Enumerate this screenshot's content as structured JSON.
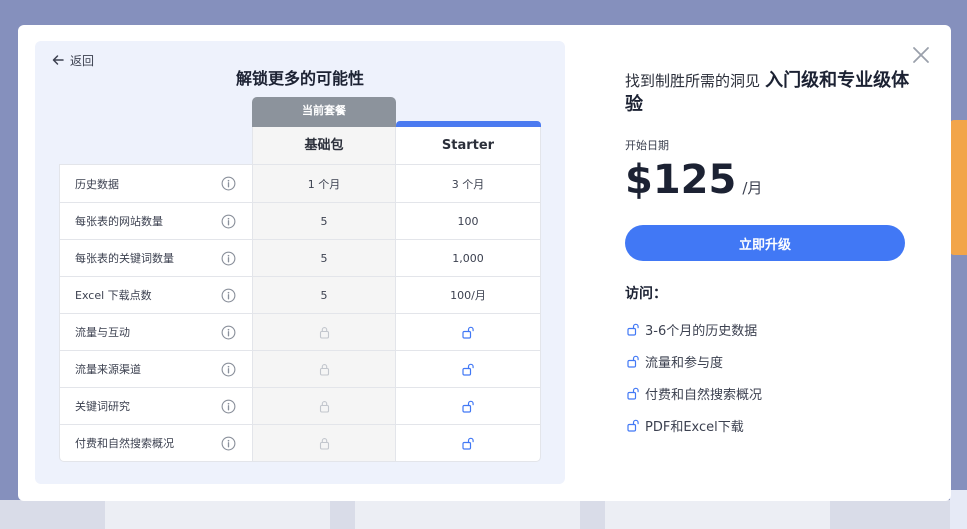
{
  "modal": {
    "back_label": "返回",
    "title": "解锁更多的可能性",
    "current_plan_tag": "当前套餐",
    "columns": {
      "basic": "基础包",
      "starter": "Starter"
    },
    "rows": [
      {
        "label": "历史数据",
        "basic": "1 个月",
        "starter": "3 个月"
      },
      {
        "label": "每张表的网站数量",
        "basic": "5",
        "starter": "100"
      },
      {
        "label": "每张表的关键词数量",
        "basic": "5",
        "starter": "1,000"
      },
      {
        "label": "Excel 下载点数",
        "basic": "5",
        "starter": "100/月"
      },
      {
        "label": "流量与互动",
        "basic_locked": true,
        "starter_unlocked": true
      },
      {
        "label": "流量来源渠道",
        "basic_locked": true,
        "starter_unlocked": true
      },
      {
        "label": "关键词研究",
        "basic_locked": true,
        "starter_unlocked": true
      },
      {
        "label": "付费和自然搜索概况",
        "basic_locked": true,
        "starter_unlocked": true
      }
    ]
  },
  "offer": {
    "headline_light": "找到制胜所需的洞见",
    "headline_bold": "入门级和专业级体验",
    "start_label": "开始日期",
    "price": "$125",
    "period": "/月",
    "upgrade_button": "立即升级",
    "access_title": "访问：",
    "access_items": [
      "3-6个月的历史数据",
      "流量和参与度",
      "付费和自然搜索概况",
      "PDF和Excel下载"
    ]
  },
  "icons": {
    "close": "close-icon",
    "back": "arrow-left-icon",
    "info": "info-icon",
    "lock": "lock-icon",
    "unlock": "unlock-icon"
  },
  "colors": {
    "accent": "#4178f5",
    "starter_bar": "#4b7af0",
    "current_tag": "#8c939c",
    "panel_bg": "#eef2fc"
  }
}
